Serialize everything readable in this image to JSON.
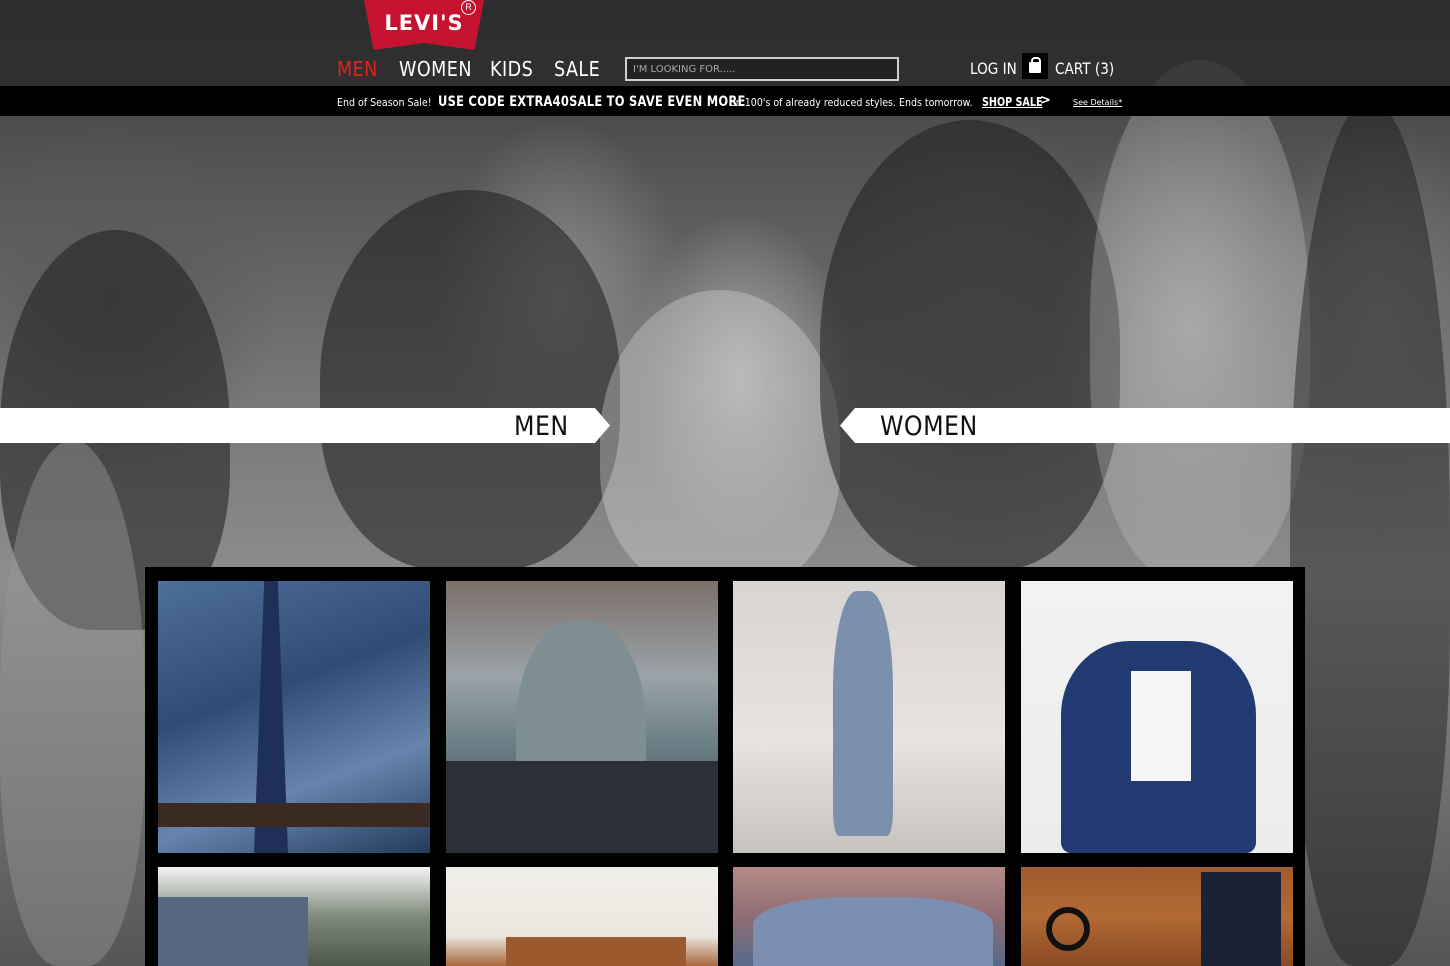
{
  "header": {
    "logo_text": "LEVI'S",
    "logo_reg": "R",
    "nav": [
      {
        "label": "MEN",
        "active": true
      },
      {
        "label": "WOMEN"
      },
      {
        "label": "KIDS"
      },
      {
        "label": "SALE"
      }
    ],
    "search_placeholder": "I'M LOOKING FOR.....",
    "login_label": "LOG IN",
    "cart_icon": "shopping-bag-icon",
    "cart_label": "CART (3)"
  },
  "promo": {
    "intro": "End of Season Sale!",
    "code_text": "USE CODE EXTRA40SALE TO SAVE EVEN MORE",
    "detail": "on 100's of already reduced styles. Ends tomorrow.",
    "shop_label": "SHOP SALE",
    "shop_arrow": ">",
    "details_label": "See Details*"
  },
  "hero": {
    "men_label": "MEN",
    "women_label": "WOMEN"
  },
  "grid": {
    "tiles": [
      {
        "subject": "denim western shirt with knit tie"
      },
      {
        "subject": "man in grey tee leaning on car"
      },
      {
        "subject": "woman in white crop tee and baggy jeans"
      },
      {
        "subject": "woman in denim jacket and white tee"
      },
      {
        "subject": "back pocket of jeans"
      },
      {
        "subject": "light interior with wooden furniture"
      },
      {
        "subject": "close-up of frayed denim"
      },
      {
        "subject": "flat lay of jeans, headphones and camera"
      }
    ]
  },
  "colors": {
    "brand_red": "#c41230",
    "active_nav": "#e2231a",
    "promo_bg": "#000000"
  }
}
